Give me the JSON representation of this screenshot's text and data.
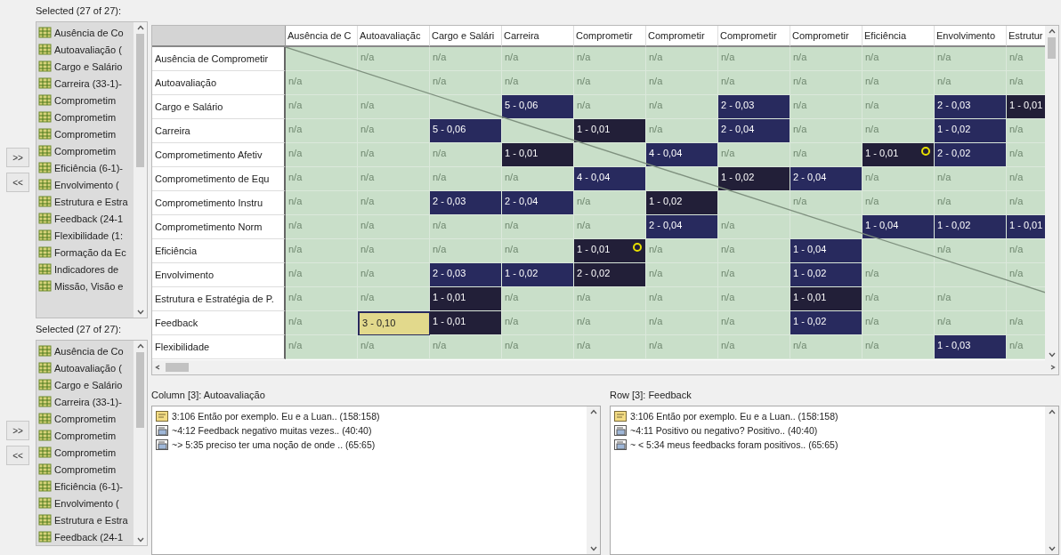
{
  "code_lists": [
    {
      "label": "Selected (27 of 27):",
      "buttons": [
        ">>",
        "<<"
      ],
      "items": [
        "Ausência de Co",
        "Autoavaliação (",
        "Cargo e Salário",
        "Carreira (33-1)-",
        "Comprometim",
        "Comprometim",
        "Comprometim",
        "Comprometim",
        "Eficiência (6-1)-",
        "Envolvimento (",
        "Estrutura e Estra",
        "Feedback (24-1",
        "Flexibilidade (1:",
        "Formação da Ec",
        "Indicadores de",
        "Missão, Visão e"
      ]
    },
    {
      "label": "Selected (27 of 27):",
      "buttons": [
        ">>",
        "<<"
      ],
      "items": [
        "Ausência de Co",
        "Autoavaliação (",
        "Cargo e Salário",
        "Carreira (33-1)-",
        "Comprometim",
        "Comprometim",
        "Comprometim",
        "Comprometim",
        "Eficiência (6-1)-",
        "Envolvimento (",
        "Estrutura e Estra",
        "Feedback (24-1"
      ]
    }
  ],
  "matrix": {
    "columns": [
      "Ausência de C",
      "Autoavaliaçãc",
      "Cargo e Salári",
      "Carreira",
      "Comprometir",
      "Comprometir",
      "Comprometir",
      "Comprometir",
      "Eficiência",
      "Envolvimento",
      "Estrutur"
    ],
    "rows": [
      {
        "label": "Ausência de Comprometir",
        "cells": [
          {
            "kind": "blank",
            "selected": false
          },
          {
            "kind": "na",
            "text": "n/a",
            "selected": false
          },
          {
            "kind": "na",
            "text": "n/a",
            "selected": false
          },
          {
            "kind": "na",
            "text": "n/a",
            "selected": false
          },
          {
            "kind": "na",
            "text": "n/a",
            "selected": false
          },
          {
            "kind": "na",
            "text": "n/a",
            "selected": false
          },
          {
            "kind": "na",
            "text": "n/a",
            "selected": false
          },
          {
            "kind": "na",
            "text": "n/a",
            "selected": false
          },
          {
            "kind": "na",
            "text": "n/a",
            "selected": false
          },
          {
            "kind": "na",
            "text": "n/a",
            "selected": false
          },
          {
            "kind": "na",
            "text": "n/a",
            "selected": false
          }
        ]
      },
      {
        "label": "Autoavaliação",
        "cells": [
          {
            "kind": "na",
            "text": "n/a",
            "selected": false
          },
          {
            "kind": "blank",
            "selected": false
          },
          {
            "kind": "na",
            "text": "n/a",
            "selected": false
          },
          {
            "kind": "na",
            "text": "n/a",
            "selected": false
          },
          {
            "kind": "na",
            "text": "n/a",
            "selected": false
          },
          {
            "kind": "na",
            "text": "n/a",
            "selected": false
          },
          {
            "kind": "na",
            "text": "n/a",
            "selected": false
          },
          {
            "kind": "na",
            "text": "n/a",
            "selected": false
          },
          {
            "kind": "na",
            "text": "n/a",
            "selected": false
          },
          {
            "kind": "na",
            "text": "n/a",
            "selected": false
          },
          {
            "kind": "na",
            "text": "n/a",
            "selected": false
          }
        ]
      },
      {
        "label": "Cargo e Salário",
        "cells": [
          {
            "kind": "na",
            "text": "n/a",
            "selected": false
          },
          {
            "kind": "na",
            "text": "n/a",
            "selected": false
          },
          {
            "kind": "blank",
            "selected": false
          },
          {
            "kind": "value",
            "text": "5 - 0,06",
            "color": "#282a5e",
            "flagged": false,
            "selected": false
          },
          {
            "kind": "na",
            "text": "n/a",
            "selected": false
          },
          {
            "kind": "na",
            "text": "n/a",
            "selected": false
          },
          {
            "kind": "value",
            "text": "2 - 0,03",
            "color": "#282a5e",
            "flagged": false,
            "selected": false
          },
          {
            "kind": "na",
            "text": "n/a",
            "selected": false
          },
          {
            "kind": "na",
            "text": "n/a",
            "selected": false
          },
          {
            "kind": "value",
            "text": "2 - 0,03",
            "color": "#282a5e",
            "flagged": false,
            "selected": false
          },
          {
            "kind": "value",
            "text": "1 - 0,01",
            "color": "#221f38",
            "flagged": false,
            "selected": false
          }
        ]
      },
      {
        "label": "Carreira",
        "cells": [
          {
            "kind": "na",
            "text": "n/a",
            "selected": false
          },
          {
            "kind": "na",
            "text": "n/a",
            "selected": false
          },
          {
            "kind": "value",
            "text": "5 - 0,06",
            "color": "#282a5e",
            "flagged": false,
            "selected": false
          },
          {
            "kind": "blank",
            "selected": false
          },
          {
            "kind": "value",
            "text": "1 - 0,01",
            "color": "#221f38",
            "flagged": false,
            "selected": false
          },
          {
            "kind": "na",
            "text": "n/a",
            "selected": false
          },
          {
            "kind": "value",
            "text": "2 - 0,04",
            "color": "#282a5e",
            "flagged": false,
            "selected": false
          },
          {
            "kind": "na",
            "text": "n/a",
            "selected": false
          },
          {
            "kind": "na",
            "text": "n/a",
            "selected": false
          },
          {
            "kind": "value",
            "text": "1 - 0,02",
            "color": "#282a5e",
            "flagged": false,
            "selected": false
          },
          {
            "kind": "na",
            "text": "n/a",
            "selected": false
          }
        ]
      },
      {
        "label": "Comprometimento Afetiv",
        "cells": [
          {
            "kind": "na",
            "text": "n/a",
            "selected": false
          },
          {
            "kind": "na",
            "text": "n/a",
            "selected": false
          },
          {
            "kind": "na",
            "text": "n/a",
            "selected": false
          },
          {
            "kind": "value",
            "text": "1 - 0,01",
            "color": "#221f38",
            "flagged": false,
            "selected": false
          },
          {
            "kind": "blank",
            "selected": false
          },
          {
            "kind": "value",
            "text": "4 - 0,04",
            "color": "#282a5e",
            "flagged": false,
            "selected": false
          },
          {
            "kind": "na",
            "text": "n/a",
            "selected": false
          },
          {
            "kind": "na",
            "text": "n/a",
            "selected": false
          },
          {
            "kind": "value",
            "text": "1 - 0,01",
            "color": "#221f38",
            "flagged": true,
            "selected": false
          },
          {
            "kind": "value",
            "text": "2 - 0,02",
            "color": "#282a5e",
            "flagged": false,
            "selected": false
          },
          {
            "kind": "na",
            "text": "n/a",
            "selected": false
          }
        ]
      },
      {
        "label": "Comprometimento de Equ",
        "cells": [
          {
            "kind": "na",
            "text": "n/a",
            "selected": false
          },
          {
            "kind": "na",
            "text": "n/a",
            "selected": false
          },
          {
            "kind": "na",
            "text": "n/a",
            "selected": false
          },
          {
            "kind": "na",
            "text": "n/a",
            "selected": false
          },
          {
            "kind": "value",
            "text": "4 - 0,04",
            "color": "#282a5e",
            "flagged": false,
            "selected": false
          },
          {
            "kind": "blank",
            "selected": false
          },
          {
            "kind": "value",
            "text": "1 - 0,02",
            "color": "#221f38",
            "flagged": false,
            "selected": false
          },
          {
            "kind": "value",
            "text": "2 - 0,04",
            "color": "#282a5e",
            "flagged": false,
            "selected": false
          },
          {
            "kind": "na",
            "text": "n/a",
            "selected": false
          },
          {
            "kind": "na",
            "text": "n/a",
            "selected": false
          },
          {
            "kind": "na",
            "text": "n/a",
            "selected": false
          }
        ]
      },
      {
        "label": "Comprometimento Instru",
        "cells": [
          {
            "kind": "na",
            "text": "n/a",
            "selected": false
          },
          {
            "kind": "na",
            "text": "n/a",
            "selected": false
          },
          {
            "kind": "value",
            "text": "2 - 0,03",
            "color": "#282a5e",
            "flagged": false,
            "selected": false
          },
          {
            "kind": "value",
            "text": "2 - 0,04",
            "color": "#282a5e",
            "flagged": false,
            "selected": false
          },
          {
            "kind": "na",
            "text": "n/a",
            "selected": false
          },
          {
            "kind": "value",
            "text": "1 - 0,02",
            "color": "#221f38",
            "flagged": false,
            "selected": false
          },
          {
            "kind": "blank",
            "selected": false
          },
          {
            "kind": "na",
            "text": "n/a",
            "selected": false
          },
          {
            "kind": "na",
            "text": "n/a",
            "selected": false
          },
          {
            "kind": "na",
            "text": "n/a",
            "selected": false
          },
          {
            "kind": "na",
            "text": "n/a",
            "selected": false
          }
        ]
      },
      {
        "label": "Comprometimento Norm",
        "cells": [
          {
            "kind": "na",
            "text": "n/a",
            "selected": false
          },
          {
            "kind": "na",
            "text": "n/a",
            "selected": false
          },
          {
            "kind": "na",
            "text": "n/a",
            "selected": false
          },
          {
            "kind": "na",
            "text": "n/a",
            "selected": false
          },
          {
            "kind": "na",
            "text": "n/a",
            "selected": false
          },
          {
            "kind": "value",
            "text": "2 - 0,04",
            "color": "#282a5e",
            "flagged": false,
            "selected": false
          },
          {
            "kind": "na",
            "text": "n/a",
            "selected": false
          },
          {
            "kind": "blank",
            "selected": false
          },
          {
            "kind": "value",
            "text": "1 - 0,04",
            "color": "#282a5e",
            "flagged": false,
            "selected": false
          },
          {
            "kind": "value",
            "text": "1 - 0,02",
            "color": "#282a5e",
            "flagged": false,
            "selected": false
          },
          {
            "kind": "value",
            "text": "1 - 0,01",
            "color": "#282a5e",
            "flagged": false,
            "selected": false
          }
        ]
      },
      {
        "label": "Eficiência",
        "cells": [
          {
            "kind": "na",
            "text": "n/a",
            "selected": false
          },
          {
            "kind": "na",
            "text": "n/a",
            "selected": false
          },
          {
            "kind": "na",
            "text": "n/a",
            "selected": false
          },
          {
            "kind": "na",
            "text": "n/a",
            "selected": false
          },
          {
            "kind": "value",
            "text": "1 - 0,01",
            "color": "#221f38",
            "flagged": true,
            "selected": false
          },
          {
            "kind": "na",
            "text": "n/a",
            "selected": false
          },
          {
            "kind": "na",
            "text": "n/a",
            "selected": false
          },
          {
            "kind": "value",
            "text": "1 - 0,04",
            "color": "#282a5e",
            "flagged": false,
            "selected": false
          },
          {
            "kind": "blank",
            "selected": false
          },
          {
            "kind": "na",
            "text": "n/a",
            "selected": false
          },
          {
            "kind": "na",
            "text": "n/a",
            "selected": false
          }
        ]
      },
      {
        "label": "Envolvimento",
        "cells": [
          {
            "kind": "na",
            "text": "n/a",
            "selected": false
          },
          {
            "kind": "na",
            "text": "n/a",
            "selected": false
          },
          {
            "kind": "value",
            "text": "2 - 0,03",
            "color": "#282a5e",
            "flagged": false,
            "selected": false
          },
          {
            "kind": "value",
            "text": "1 - 0,02",
            "color": "#282a5e",
            "flagged": false,
            "selected": false
          },
          {
            "kind": "value",
            "text": "2 - 0,02",
            "color": "#221f38",
            "flagged": false,
            "selected": false
          },
          {
            "kind": "na",
            "text": "n/a",
            "selected": false
          },
          {
            "kind": "na",
            "text": "n/a",
            "selected": false
          },
          {
            "kind": "value",
            "text": "1 - 0,02",
            "color": "#282a5e",
            "flagged": false,
            "selected": false
          },
          {
            "kind": "na",
            "text": "n/a",
            "selected": false
          },
          {
            "kind": "blank",
            "selected": false
          },
          {
            "kind": "na",
            "text": "n/a",
            "selected": false
          }
        ]
      },
      {
        "label": "Estrutura e Estratégia de P.",
        "cells": [
          {
            "kind": "na",
            "text": "n/a",
            "selected": false
          },
          {
            "kind": "na",
            "text": "n/a",
            "selected": false
          },
          {
            "kind": "value",
            "text": "1 - 0,01",
            "color": "#221f38",
            "flagged": false,
            "selected": false
          },
          {
            "kind": "na",
            "text": "n/a",
            "selected": false
          },
          {
            "kind": "na",
            "text": "n/a",
            "selected": false
          },
          {
            "kind": "na",
            "text": "n/a",
            "selected": false
          },
          {
            "kind": "na",
            "text": "n/a",
            "selected": false
          },
          {
            "kind": "value",
            "text": "1 - 0,01",
            "color": "#221f38",
            "flagged": false,
            "selected": false
          },
          {
            "kind": "na",
            "text": "n/a",
            "selected": false
          },
          {
            "kind": "na",
            "text": "n/a",
            "selected": false
          },
          {
            "kind": "blank",
            "selected": false
          }
        ]
      },
      {
        "label": "Feedback",
        "cells": [
          {
            "kind": "na",
            "text": "n/a",
            "selected": false
          },
          {
            "kind": "value",
            "text": "3 - 0,10",
            "color": "#282a5e",
            "flagged": false,
            "selected": true
          },
          {
            "kind": "value",
            "text": "1 - 0,01",
            "color": "#221f38",
            "flagged": false,
            "selected": false
          },
          {
            "kind": "na",
            "text": "n/a",
            "selected": false
          },
          {
            "kind": "na",
            "text": "n/a",
            "selected": false
          },
          {
            "kind": "na",
            "text": "n/a",
            "selected": false
          },
          {
            "kind": "na",
            "text": "n/a",
            "selected": false
          },
          {
            "kind": "value",
            "text": "1 - 0,02",
            "color": "#282a5e",
            "flagged": false,
            "selected": false
          },
          {
            "kind": "na",
            "text": "n/a",
            "selected": false
          },
          {
            "kind": "na",
            "text": "n/a",
            "selected": false
          },
          {
            "kind": "na",
            "text": "n/a",
            "selected": false
          }
        ]
      },
      {
        "label": "Flexibilidade",
        "cells": [
          {
            "kind": "na",
            "text": "n/a",
            "selected": false
          },
          {
            "kind": "na",
            "text": "n/a",
            "selected": false
          },
          {
            "kind": "na",
            "text": "n/a",
            "selected": false
          },
          {
            "kind": "na",
            "text": "n/a",
            "selected": false
          },
          {
            "kind": "na",
            "text": "n/a",
            "selected": false
          },
          {
            "kind": "na",
            "text": "n/a",
            "selected": false
          },
          {
            "kind": "na",
            "text": "n/a",
            "selected": false
          },
          {
            "kind": "na",
            "text": "n/a",
            "selected": false
          },
          {
            "kind": "na",
            "text": "n/a",
            "selected": false
          },
          {
            "kind": "value",
            "text": "1 - 0,03",
            "color": "#282a5e",
            "flagged": false,
            "selected": false
          },
          {
            "kind": "na",
            "text": "n/a",
            "selected": false
          }
        ]
      }
    ]
  },
  "quote_panels": [
    {
      "title": "Column [3]: Autoavaliação",
      "items": [
        {
          "kind": "document",
          "text": "3:106 Então por exemplo. Eu e a Luan.. (158:158)"
        },
        {
          "kind": "linked",
          "text": "~4:12 Feedback negativo muitas vezes.. (40:40)"
        },
        {
          "kind": "linked",
          "text": "~> 5:35 preciso ter uma noção de onde .. (65:65)"
        }
      ]
    },
    {
      "title": "Row [3]: Feedback",
      "items": [
        {
          "kind": "document",
          "text": "3:106 Então por exemplo. Eu e a Luan.. (158:158)"
        },
        {
          "kind": "linked",
          "text": "~4:11 Positivo ou negativo? Positivo.. (40:40)"
        },
        {
          "kind": "linked",
          "text": "~ < 5:34 meus feedbacks foram positivos.. (65:65)"
        }
      ]
    }
  ]
}
